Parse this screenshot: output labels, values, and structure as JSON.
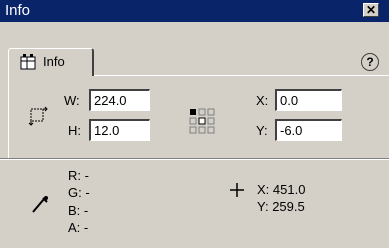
{
  "window": {
    "title": "Info",
    "close_symbol": "✕"
  },
  "tab": {
    "label": "Info",
    "icon": "info-panel-icon"
  },
  "help_symbol": "?",
  "size": {
    "w_label": "W:",
    "w_value": "224.0",
    "h_label": "H:",
    "h_value": "12.0"
  },
  "position": {
    "x_label": "X:",
    "x_value": "0.0",
    "y_label": "Y:",
    "y_value": "-6.0"
  },
  "color": {
    "r_label": "R:",
    "r_value": "-",
    "g_label": "G:",
    "g_value": "-",
    "b_label": "B:",
    "b_value": "-",
    "a_label": "A:",
    "a_value": "-"
  },
  "cursor": {
    "x_label": "X:",
    "x_value": "451.0",
    "y_label": "Y:",
    "y_value": "259.5"
  },
  "colors": {
    "titlebar": "#0a246a",
    "panel": "#d4d0c8"
  }
}
